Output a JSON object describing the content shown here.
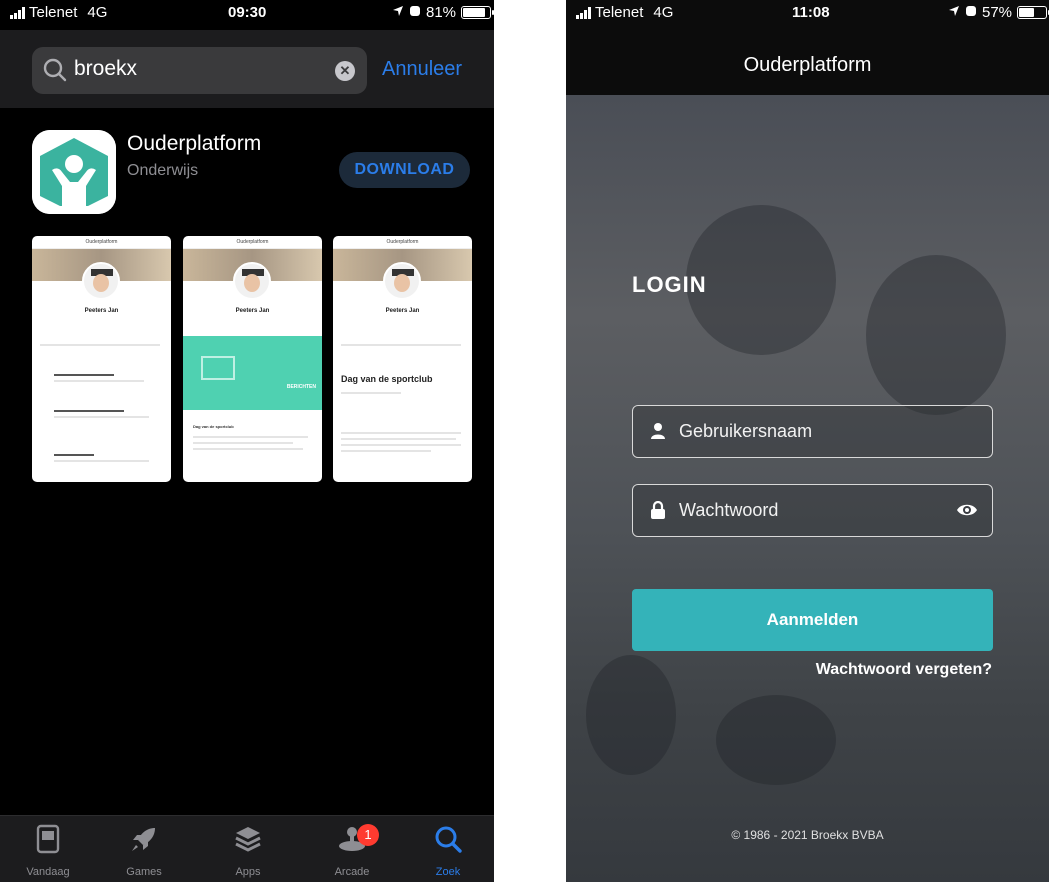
{
  "left_phone": {
    "status": {
      "carrier": "Telenet",
      "network": "4G",
      "time": "09:30",
      "battery": "81%"
    },
    "search": {
      "query": "broekx",
      "cancel_label": "Annuleer"
    },
    "result": {
      "app_name": "Ouderplatform",
      "category": "Onderwijs",
      "download_label": "DOWNLOAD",
      "icon": "ouderplatform-app-icon"
    },
    "screenshots": [
      {
        "header": "Ouderplatform",
        "name": "Peeters Jan",
        "variant": "list"
      },
      {
        "header": "Ouderplatform",
        "name": "Peeters Jan",
        "variant": "messages",
        "banner_label": "BERICHTEN",
        "item_title": "Dag van de sportclub"
      },
      {
        "header": "Ouderplatform",
        "name": "Peeters Jan",
        "variant": "detail",
        "big_title": "Dag van de sportclub"
      }
    ],
    "tabbar": [
      {
        "label": "Vandaag",
        "icon": "today-icon"
      },
      {
        "label": "Games",
        "icon": "rocket-icon"
      },
      {
        "label": "Apps",
        "icon": "apps-stack-icon"
      },
      {
        "label": "Arcade",
        "icon": "joystick-icon",
        "badge": "1"
      },
      {
        "label": "Zoek",
        "icon": "search-icon",
        "active": true
      }
    ]
  },
  "right_phone": {
    "status": {
      "carrier": "Telenet",
      "network": "4G",
      "time": "11:08",
      "battery": "57%"
    },
    "title": "Ouderplatform",
    "login": {
      "heading": "LOGIN",
      "username_placeholder": "Gebruikersnaam",
      "password_placeholder": "Wachtwoord",
      "submit_label": "Aanmelden",
      "forgot_label": "Wachtwoord vergeten?"
    },
    "footer": "© 1986 - 2021 Broekx BVBA"
  },
  "colors": {
    "ios_blue": "#2b7de9",
    "teal_button": "#34b3b9",
    "app_icon_teal": "#3bb39f",
    "badge_red": "#ff3b30"
  }
}
